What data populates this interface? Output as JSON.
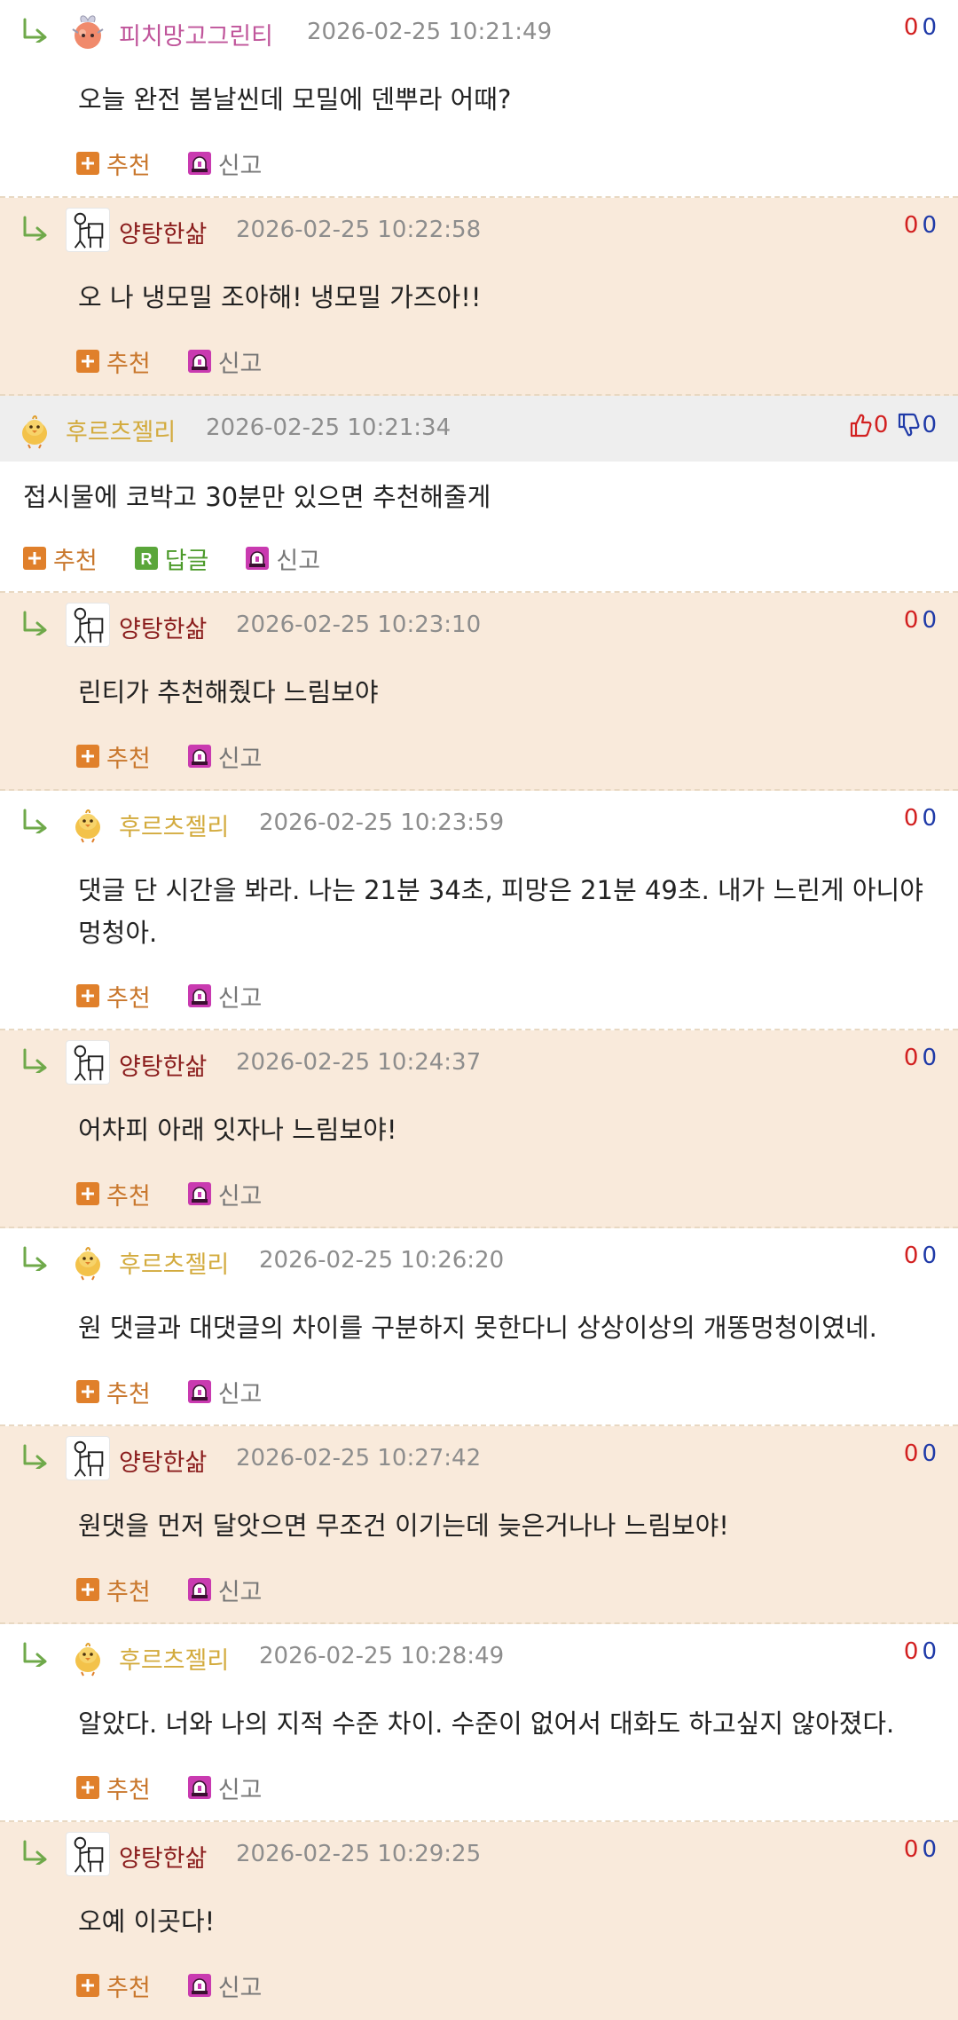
{
  "colors": {
    "reply_bg_white": "#ffffff",
    "reply_bg_peach": "#f9eadb",
    "root_header_bg": "#eeeeee",
    "recommend": "#c9772c",
    "answer": "#4c9a2a",
    "report": "#777777",
    "vote_up": "#d22020",
    "vote_down": "#1f3aa8"
  },
  "labels": {
    "recommend": "추천",
    "answer": "답글",
    "report": "신고"
  },
  "comments": [
    {
      "kind": "reply",
      "author": "피치망고그린티",
      "avatar_icon": "peach-character-icon",
      "time": "2026-02-25 10:21:49",
      "body": [
        "오늘 완전 봄날씬데 모밀에 덴뿌라 어때?"
      ],
      "up": "0",
      "down": "0"
    },
    {
      "kind": "reply",
      "author": "양탕한삶",
      "avatar_icon": "stick-figure-icon",
      "time": "2026-02-25 10:22:58",
      "body": [
        "오 나 냉모밀 조아해! 냉모밀 가즈아!!"
      ],
      "up": "0",
      "down": "0"
    },
    {
      "kind": "root",
      "author": "후르츠젤리",
      "avatar_icon": "chick-icon",
      "time": "2026-02-25 10:21:34",
      "body": [
        "접시물에 코박고 30분만 있으면 추천해줄게"
      ],
      "up": "0",
      "down": "0"
    },
    {
      "kind": "reply",
      "author": "양탕한삶",
      "avatar_icon": "stick-figure-icon",
      "time": "2026-02-25 10:23:10",
      "body": [
        "린티가 추천해줬다 느림보야"
      ],
      "up": "0",
      "down": "0"
    },
    {
      "kind": "reply",
      "author": "후르츠젤리",
      "avatar_icon": "chick-icon",
      "time": "2026-02-25 10:23:59",
      "body": [
        "댓글 단 시간을 봐라. 나는 21분 34초, 피망은 21분 49초. 내가 느린게 아니야",
        "멍청아."
      ],
      "up": "0",
      "down": "0"
    },
    {
      "kind": "reply",
      "author": "양탕한삶",
      "avatar_icon": "stick-figure-icon",
      "time": "2026-02-25 10:24:37",
      "body": [
        "어차피 아래 잇자나 느림보야!"
      ],
      "up": "0",
      "down": "0"
    },
    {
      "kind": "reply",
      "author": "후르츠젤리",
      "avatar_icon": "chick-icon",
      "time": "2026-02-25 10:26:20",
      "body": [
        "원 댓글과 대댓글의 차이를 구분하지 못한다니 상상이상의 개똥멍청이였네."
      ],
      "up": "0",
      "down": "0"
    },
    {
      "kind": "reply",
      "author": "양탕한삶",
      "avatar_icon": "stick-figure-icon",
      "time": "2026-02-25 10:27:42",
      "body": [
        "원댓을 먼저 달앗으면 무조건 이기는데 늦은거나나 느림보야!"
      ],
      "up": "0",
      "down": "0"
    },
    {
      "kind": "reply",
      "author": "후르츠젤리",
      "avatar_icon": "chick-icon",
      "time": "2026-02-25 10:28:49",
      "body": [
        "알았다. 너와 나의 지적 수준 차이. 수준이 없어서 대화도 하고싶지 않아졌다."
      ],
      "up": "0",
      "down": "0"
    },
    {
      "kind": "reply",
      "author": "양탕한삶",
      "avatar_icon": "stick-figure-icon",
      "time": "2026-02-25 10:29:25",
      "body": [
        "오예 이곳다!"
      ],
      "up": "0",
      "down": "0"
    }
  ]
}
